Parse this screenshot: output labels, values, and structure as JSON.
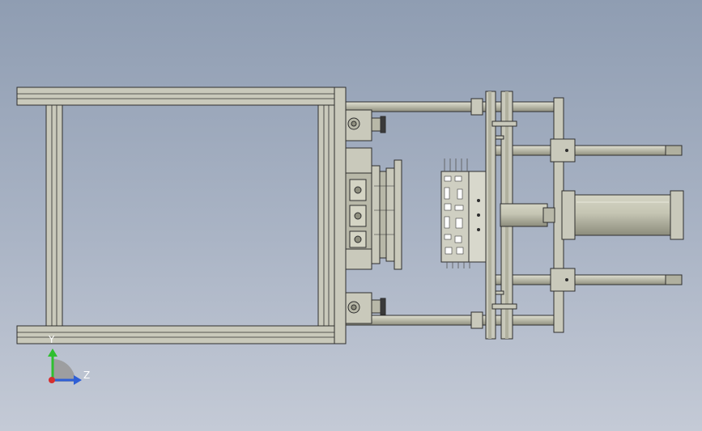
{
  "viewport": {
    "background_top": "#8f9db2",
    "background_bottom": "#c4cad6"
  },
  "colors": {
    "part_fill": "#c9c9bb",
    "part_shade": "#a9a999",
    "outline": "#2e2e2e",
    "axis_y": "#2fbf2f",
    "axis_z": "#2f5fd6",
    "axis_origin": "#d62f2f"
  },
  "triad": {
    "y_label": "Y",
    "z_label": "Z",
    "icon": "coordinate-triad-icon"
  }
}
